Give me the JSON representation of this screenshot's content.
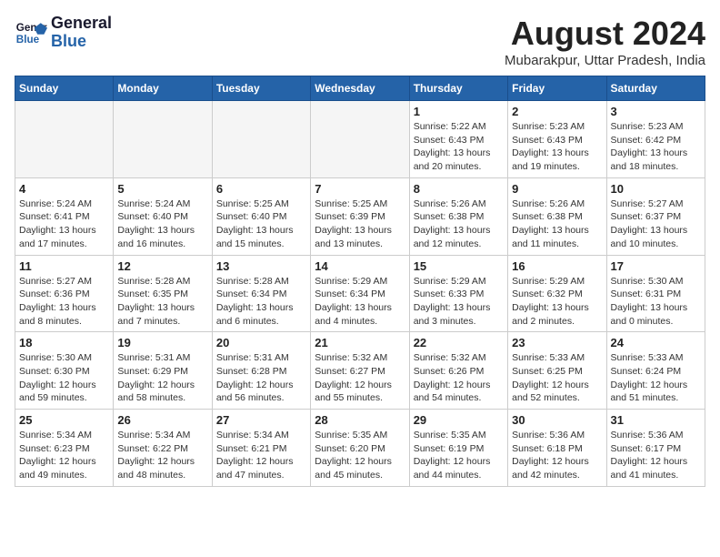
{
  "header": {
    "logo_line1": "General",
    "logo_line2": "Blue",
    "month_year": "August 2024",
    "location": "Mubarakpur, Uttar Pradesh, India"
  },
  "days_of_week": [
    "Sunday",
    "Monday",
    "Tuesday",
    "Wednesday",
    "Thursday",
    "Friday",
    "Saturday"
  ],
  "weeks": [
    [
      {
        "day": "",
        "info": ""
      },
      {
        "day": "",
        "info": ""
      },
      {
        "day": "",
        "info": ""
      },
      {
        "day": "",
        "info": ""
      },
      {
        "day": "1",
        "info": "Sunrise: 5:22 AM\nSunset: 6:43 PM\nDaylight: 13 hours\nand 20 minutes."
      },
      {
        "day": "2",
        "info": "Sunrise: 5:23 AM\nSunset: 6:43 PM\nDaylight: 13 hours\nand 19 minutes."
      },
      {
        "day": "3",
        "info": "Sunrise: 5:23 AM\nSunset: 6:42 PM\nDaylight: 13 hours\nand 18 minutes."
      }
    ],
    [
      {
        "day": "4",
        "info": "Sunrise: 5:24 AM\nSunset: 6:41 PM\nDaylight: 13 hours\nand 17 minutes."
      },
      {
        "day": "5",
        "info": "Sunrise: 5:24 AM\nSunset: 6:40 PM\nDaylight: 13 hours\nand 16 minutes."
      },
      {
        "day": "6",
        "info": "Sunrise: 5:25 AM\nSunset: 6:40 PM\nDaylight: 13 hours\nand 15 minutes."
      },
      {
        "day": "7",
        "info": "Sunrise: 5:25 AM\nSunset: 6:39 PM\nDaylight: 13 hours\nand 13 minutes."
      },
      {
        "day": "8",
        "info": "Sunrise: 5:26 AM\nSunset: 6:38 PM\nDaylight: 13 hours\nand 12 minutes."
      },
      {
        "day": "9",
        "info": "Sunrise: 5:26 AM\nSunset: 6:38 PM\nDaylight: 13 hours\nand 11 minutes."
      },
      {
        "day": "10",
        "info": "Sunrise: 5:27 AM\nSunset: 6:37 PM\nDaylight: 13 hours\nand 10 minutes."
      }
    ],
    [
      {
        "day": "11",
        "info": "Sunrise: 5:27 AM\nSunset: 6:36 PM\nDaylight: 13 hours\nand 8 minutes."
      },
      {
        "day": "12",
        "info": "Sunrise: 5:28 AM\nSunset: 6:35 PM\nDaylight: 13 hours\nand 7 minutes."
      },
      {
        "day": "13",
        "info": "Sunrise: 5:28 AM\nSunset: 6:34 PM\nDaylight: 13 hours\nand 6 minutes."
      },
      {
        "day": "14",
        "info": "Sunrise: 5:29 AM\nSunset: 6:34 PM\nDaylight: 13 hours\nand 4 minutes."
      },
      {
        "day": "15",
        "info": "Sunrise: 5:29 AM\nSunset: 6:33 PM\nDaylight: 13 hours\nand 3 minutes."
      },
      {
        "day": "16",
        "info": "Sunrise: 5:29 AM\nSunset: 6:32 PM\nDaylight: 13 hours\nand 2 minutes."
      },
      {
        "day": "17",
        "info": "Sunrise: 5:30 AM\nSunset: 6:31 PM\nDaylight: 13 hours\nand 0 minutes."
      }
    ],
    [
      {
        "day": "18",
        "info": "Sunrise: 5:30 AM\nSunset: 6:30 PM\nDaylight: 12 hours\nand 59 minutes."
      },
      {
        "day": "19",
        "info": "Sunrise: 5:31 AM\nSunset: 6:29 PM\nDaylight: 12 hours\nand 58 minutes."
      },
      {
        "day": "20",
        "info": "Sunrise: 5:31 AM\nSunset: 6:28 PM\nDaylight: 12 hours\nand 56 minutes."
      },
      {
        "day": "21",
        "info": "Sunrise: 5:32 AM\nSunset: 6:27 PM\nDaylight: 12 hours\nand 55 minutes."
      },
      {
        "day": "22",
        "info": "Sunrise: 5:32 AM\nSunset: 6:26 PM\nDaylight: 12 hours\nand 54 minutes."
      },
      {
        "day": "23",
        "info": "Sunrise: 5:33 AM\nSunset: 6:25 PM\nDaylight: 12 hours\nand 52 minutes."
      },
      {
        "day": "24",
        "info": "Sunrise: 5:33 AM\nSunset: 6:24 PM\nDaylight: 12 hours\nand 51 minutes."
      }
    ],
    [
      {
        "day": "25",
        "info": "Sunrise: 5:34 AM\nSunset: 6:23 PM\nDaylight: 12 hours\nand 49 minutes."
      },
      {
        "day": "26",
        "info": "Sunrise: 5:34 AM\nSunset: 6:22 PM\nDaylight: 12 hours\nand 48 minutes."
      },
      {
        "day": "27",
        "info": "Sunrise: 5:34 AM\nSunset: 6:21 PM\nDaylight: 12 hours\nand 47 minutes."
      },
      {
        "day": "28",
        "info": "Sunrise: 5:35 AM\nSunset: 6:20 PM\nDaylight: 12 hours\nand 45 minutes."
      },
      {
        "day": "29",
        "info": "Sunrise: 5:35 AM\nSunset: 6:19 PM\nDaylight: 12 hours\nand 44 minutes."
      },
      {
        "day": "30",
        "info": "Sunrise: 5:36 AM\nSunset: 6:18 PM\nDaylight: 12 hours\nand 42 minutes."
      },
      {
        "day": "31",
        "info": "Sunrise: 5:36 AM\nSunset: 6:17 PM\nDaylight: 12 hours\nand 41 minutes."
      }
    ]
  ]
}
